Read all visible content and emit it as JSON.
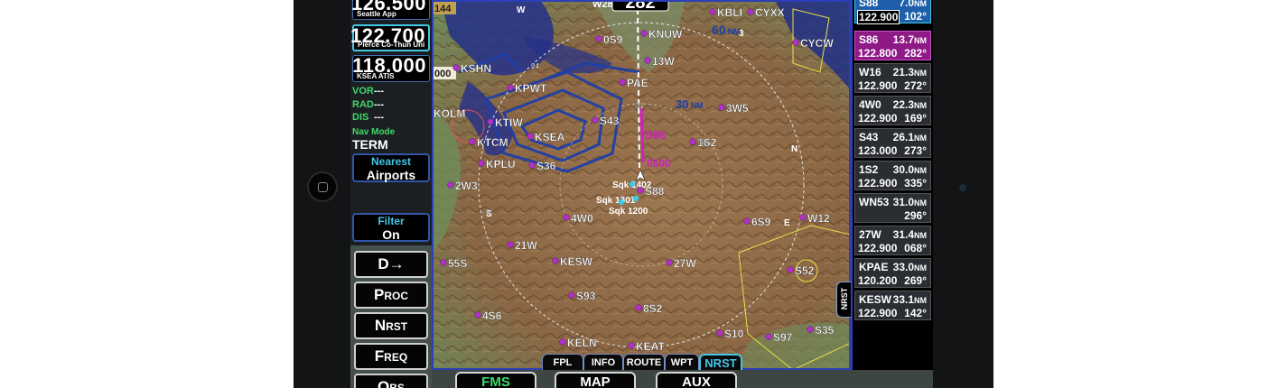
{
  "left": {
    "freqs": [
      {
        "value": "126.500",
        "name": "Seattle App",
        "active": false
      },
      {
        "value": "122.700",
        "name": "Pierce Co-Thun Uni",
        "active": true
      },
      {
        "value": "118.000",
        "name": "KSEA ATIS",
        "active": false
      }
    ],
    "nav": [
      {
        "key": "VOR",
        "value": "---"
      },
      {
        "key": "RAD",
        "value": "---"
      },
      {
        "key": "DIS",
        "value": "---"
      }
    ],
    "nav_mode_label": "Nav Mode",
    "nav_mode_value": "TERM",
    "nearest": {
      "line1": "Nearest",
      "line2": "Airports"
    },
    "filter": {
      "line1": "Filter",
      "line2": "On"
    },
    "keys": [
      "D→",
      "Proc",
      "Nrst",
      "Freq",
      "Obs"
    ]
  },
  "map": {
    "heading": "282",
    "compass": [
      "W28",
      "W",
      "N",
      "3",
      "S",
      "E"
    ],
    "ranges": [
      "60",
      "30"
    ],
    "range_unit": "NM",
    "magenta_labels": [
      "S86",
      "0500"
    ],
    "traffic": [
      "Sqk 1402",
      "Sqk 1301",
      "Sqk 1200"
    ],
    "badges": [
      "144",
      "000"
    ],
    "airports_bold": [
      "KBLI",
      "CYXX",
      "KNUW",
      "0S9",
      "13W",
      "CYCW",
      "KSHN",
      "PAE",
      "KPWT",
      "KOLM",
      "KTIW",
      "KSEA",
      "S43",
      "KTCM",
      "1S2",
      "3W5",
      "S88",
      "KPLU",
      "S36",
      "2W3",
      "4W0",
      "6S9",
      "W12",
      "21W",
      "KESW",
      "27W",
      "55S",
      "S52",
      "S93",
      "4S6",
      "8S2",
      "S10",
      "S97",
      "S35",
      "KELN",
      "KEAT"
    ],
    "airports_small": [
      "24",
      "31",
      "32",
      "5"
    ]
  },
  "tabs": [
    "FPL",
    "INFO",
    "ROUTE",
    "WPT",
    "NRST"
  ],
  "active_tab": "NRST",
  "bottom_buttons": [
    "FMS",
    "MAP",
    "AUX"
  ],
  "side_tab": "NRST",
  "nearest_list": [
    {
      "id": "S88",
      "dist": "7.0",
      "unit": "NM",
      "freq": "122.900",
      "brg": "102°",
      "style": "sel"
    },
    {
      "id": "S86",
      "dist": "13.7",
      "unit": "NM",
      "freq": "122.800",
      "brg": "282°",
      "style": "mag"
    },
    {
      "id": "W16",
      "dist": "21.3",
      "unit": "NM",
      "freq": "122.900",
      "brg": "272°",
      "style": ""
    },
    {
      "id": "4W0",
      "dist": "22.3",
      "unit": "NM",
      "freq": "122.900",
      "brg": "169°",
      "style": ""
    },
    {
      "id": "S43",
      "dist": "26.1",
      "unit": "NM",
      "freq": "123.000",
      "brg": "273°",
      "style": ""
    },
    {
      "id": "1S2",
      "dist": "30.0",
      "unit": "NM",
      "freq": "122.900",
      "brg": "335°",
      "style": ""
    },
    {
      "id": "WN53",
      "dist": "31.0",
      "unit": "NM",
      "freq": "",
      "brg": "296°",
      "style": ""
    },
    {
      "id": "27W",
      "dist": "31.4",
      "unit": "NM",
      "freq": "122.900",
      "brg": "068°",
      "style": ""
    },
    {
      "id": "KPAE",
      "dist": "33.0",
      "unit": "NM",
      "freq": "120.200",
      "brg": "269°",
      "style": ""
    },
    {
      "id": "KESW",
      "dist": "33.1",
      "unit": "NM",
      "freq": "122.900",
      "brg": "142°",
      "style": ""
    }
  ],
  "colors": {
    "accent": "#41c8e6",
    "magenta": "#d020c0",
    "green": "#3fd86a",
    "airspace": "#1f3fa8"
  }
}
